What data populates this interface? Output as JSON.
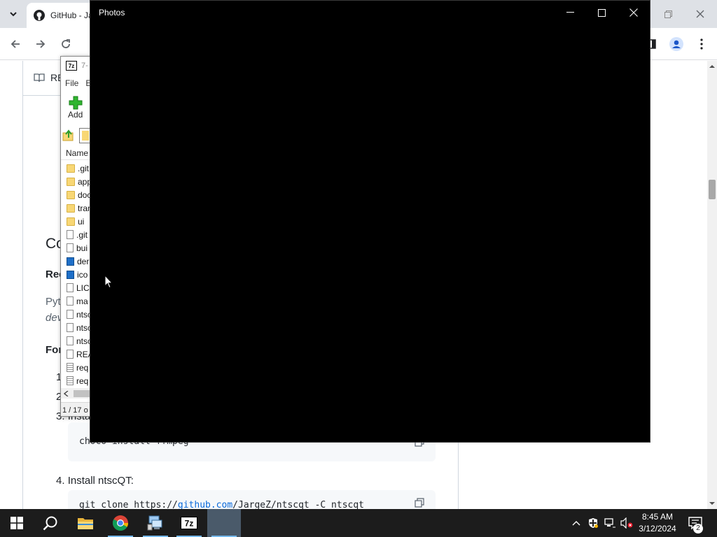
{
  "browser": {
    "tab_title": "GitHub - Ja",
    "readme_tab_label": "RE"
  },
  "github_page": {
    "heading": "Co",
    "requirements_heading": "Rec",
    "text_line1": "Pyt",
    "text_line2": "dev",
    "for_heading": "For",
    "list_items": [
      {
        "num": "1",
        "text": ""
      },
      {
        "num": "2",
        "text": ""
      },
      {
        "num": "3.",
        "text": "Insta"
      },
      {
        "num": "4.",
        "text": "Install ntscQT:"
      }
    ],
    "code_ffmpeg": "choco install ffmpeg",
    "code_clone_prefix": "git clone https://",
    "code_clone_link": "github.com",
    "code_clone_suffix": "/JargeZ/ntscqt -C ntscqt"
  },
  "sevenzip": {
    "title": "7-",
    "menu_file": "File",
    "menu_edit": "E",
    "add_label": "Add",
    "column_name": "Name",
    "files": [
      {
        "name": ".git",
        "type": "folder"
      },
      {
        "name": "app",
        "type": "folder"
      },
      {
        "name": "doc",
        "type": "folder"
      },
      {
        "name": "tran",
        "type": "folder"
      },
      {
        "name": "ui",
        "type": "folder"
      },
      {
        "name": ".git",
        "type": "file"
      },
      {
        "name": "bui",
        "type": "file"
      },
      {
        "name": "der",
        "type": "image"
      },
      {
        "name": "ico",
        "type": "image"
      },
      {
        "name": "LIC",
        "type": "file"
      },
      {
        "name": "ma",
        "type": "file"
      },
      {
        "name": "ntsc",
        "type": "file"
      },
      {
        "name": "ntsc",
        "type": "file"
      },
      {
        "name": "ntsc",
        "type": "file"
      },
      {
        "name": "REA",
        "type": "file"
      },
      {
        "name": "req",
        "type": "text"
      },
      {
        "name": "req",
        "type": "text"
      }
    ],
    "status": "1 / 17 o"
  },
  "photos": {
    "title": "Photos"
  },
  "taskbar": {
    "time": "8:45 AM",
    "date": "3/12/2024",
    "notification_count": "2"
  },
  "colors": {
    "taskbar_bg": "#1c1c1c",
    "accent_underline": "#76b9ed",
    "photos_bg": "#000000",
    "link_blue": "#0969da"
  }
}
